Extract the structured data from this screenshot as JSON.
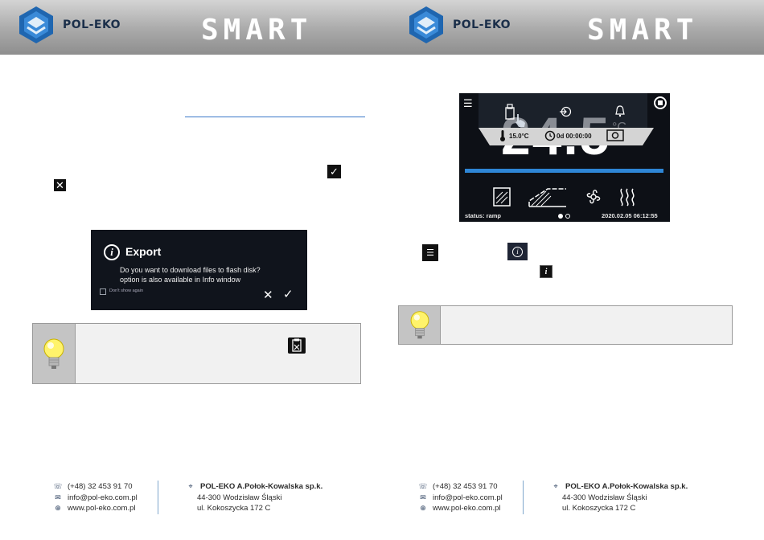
{
  "brand": {
    "name": "POL-EKO",
    "product": "SMART"
  },
  "export_dialog": {
    "title": "Export",
    "line1": "Do you want to download files to flash disk?",
    "line2": "option is also available in Info window",
    "dont_show": "Don't show again",
    "cancel": "✕",
    "confirm": "✓"
  },
  "icons": {
    "check": "✓",
    "close": "✕",
    "menu": "☰",
    "info": "i"
  },
  "device_screen": {
    "big_value": "24.5",
    "unit": "°C",
    "temperature": "15.0°C",
    "timer": "0d 00:00:00",
    "status": "status: ramp",
    "date": "2020.02.05",
    "time": "06:12:55",
    "menu": "☰"
  },
  "footer": {
    "phone": "(+48) 32 453 91 70",
    "email": "info@pol-eko.com.pl",
    "web": "www.pol-eko.com.pl",
    "company": "POL-EKO A.Połok-Kowalska sp.k.",
    "address1": "44-300 Wodzisław Śląski",
    "address2": "ul. Kokoszycka 172 C"
  },
  "colors": {
    "accent": "#2e86d6",
    "brand_blue": "#1f66b0",
    "screen_bg": "#0d1016"
  }
}
